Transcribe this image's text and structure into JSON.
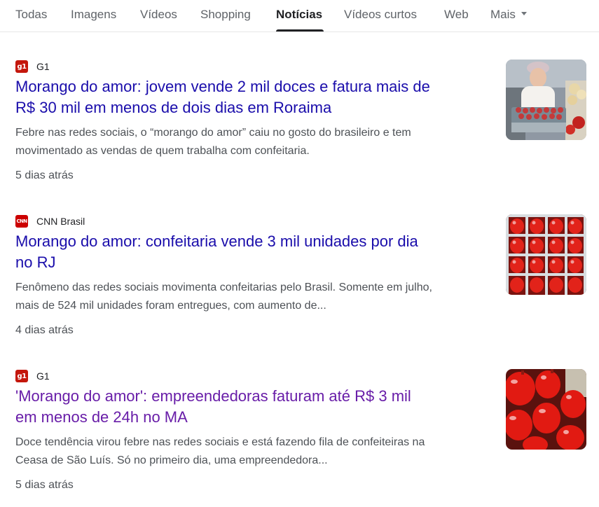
{
  "tabs": [
    {
      "label": "Todas"
    },
    {
      "label": "Imagens"
    },
    {
      "label": "Vídeos"
    },
    {
      "label": "Shopping"
    },
    {
      "label": "Notícias",
      "active": true
    },
    {
      "label": "Vídeos curtos"
    },
    {
      "label": "Web"
    },
    {
      "label": "Mais"
    }
  ],
  "results": [
    {
      "favicon": "g1",
      "source": "G1",
      "title_line1": "Morango do amor: jovem vende 2 mil doces e fatura mais de",
      "title_line2": "R$ 30 mil em menos de dois dias em Roraima",
      "snippet_line1": "Febre nas redes sociais, o “morango do amor” caiu no gosto do brasileiro e tem",
      "snippet_line2": "movimentado as vendas de quem trabalha com confeitaria.",
      "date": "5 dias atrás",
      "visited": false
    },
    {
      "favicon": "CNN",
      "source": "CNN Brasil",
      "title_line1": "Morango do amor: confeitaria vende 3 mil unidades por dia",
      "title_line2": "no RJ",
      "snippet_line1": "Fenômeno das redes sociais movimenta confeitarias pelo Brasil. Somente em julho,",
      "snippet_line2": "mais de 524 mil unidades foram entregues, com aumento de...",
      "date": "4 dias atrás",
      "visited": false
    },
    {
      "favicon": "g1",
      "source": "G1",
      "title_line1": "'Morango do amor': empreendedoras faturam até R$ 3 mil",
      "title_line2": "em menos de 24h no MA",
      "snippet_line1": "Doce tendência virou febre nas redes sociais e está fazendo fila de confeiteiras na",
      "snippet_line2": "Ceasa de São Luís. Só no primeiro dia, uma empreendedora...",
      "date": "5 dias atrás",
      "visited": true
    }
  ],
  "colors": {
    "link": "#1a0dab",
    "visited": "#681da8",
    "text": "#4d5156",
    "g1_red": "#c4170c",
    "cnn_red": "#cc0000"
  },
  "icons": {
    "more_caret": "chevron-down-icon"
  }
}
